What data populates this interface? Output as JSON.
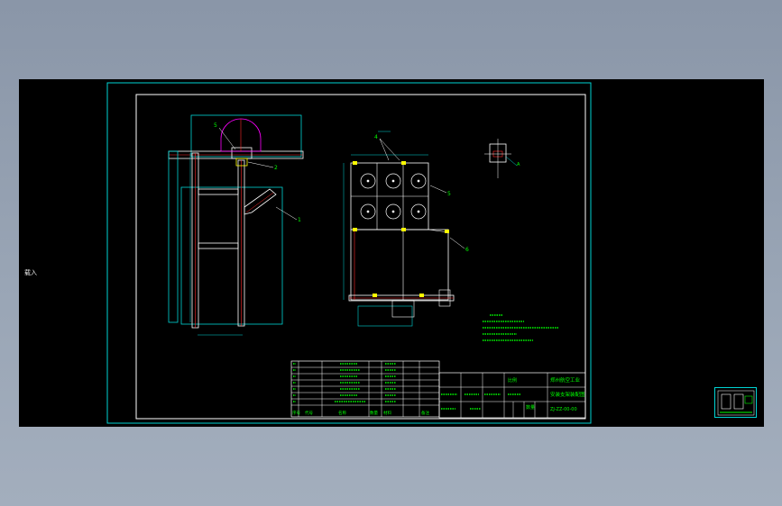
{
  "viewport": {
    "side_label": "载入"
  },
  "colors": {
    "frame": "#00d5d5",
    "text": "#00ff00",
    "part": "#ffffff",
    "hidden": "#ff2a2a",
    "accent": "#ff00ff",
    "background": "#000000",
    "yellow": "#ffff00"
  },
  "callouts": {
    "side_view": [
      "5",
      "2",
      "1"
    ],
    "front_view": [
      "4",
      "5",
      "6"
    ],
    "detail": [
      "A"
    ]
  },
  "title_block": {
    "school": "郑州航空工业",
    "drawing_name": "安装支架装配图",
    "drawing_number": "ZJ-ZZ-00-00",
    "scale_label": "比例",
    "qty_label": "数量",
    "columns": [
      "序号",
      "代号",
      "名称",
      "数量",
      "材料",
      "备注"
    ]
  },
  "parts_list_rows": 7,
  "technical_notes_lines": 5,
  "thumbnail": {
    "label": "model-preview"
  }
}
